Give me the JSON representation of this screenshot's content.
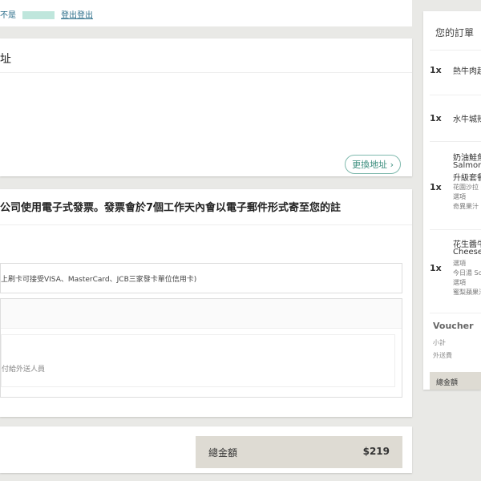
{
  "topbar": {
    "prefix": "不是",
    "logout": "登出登出"
  },
  "address": {
    "title": "址",
    "change_button": "更換地址 ›"
  },
  "payment": {
    "invoice_notice": "公司使用電子式發票。發票會於7個工作天內會以電子郵件形式寄至您的註",
    "card_option": "上刷卡可接受VISA、MasterCard、JCB三家發卡單位信用卡)",
    "cod_note": "付給外送人員"
  },
  "total": {
    "label": "總金額",
    "value": "$219"
  },
  "order": {
    "title": "您的訂單",
    "items": [
      {
        "qty": "1x",
        "name": "熱牛肉起",
        "subs": []
      },
      {
        "qty": "1x",
        "name": "水牛城辣",
        "subs": []
      },
      {
        "qty": "1x",
        "name": "奶油鮭魚",
        "subs": [
          "Salmon",
          "升級套餐",
          "花園沙拉 C",
          "選項",
          "奇異果汁 K"
        ]
      },
      {
        "qty": "1x",
        "name": "花生醬牛",
        "subs": [
          "Cheese",
          "選項",
          "今日湯 Sou",
          "選項",
          "蜜梨蘋果汁"
        ]
      }
    ],
    "voucher": "Voucher",
    "subtotal_label": "小計",
    "delivery_label": "外送費",
    "grand_label": "總金額"
  }
}
